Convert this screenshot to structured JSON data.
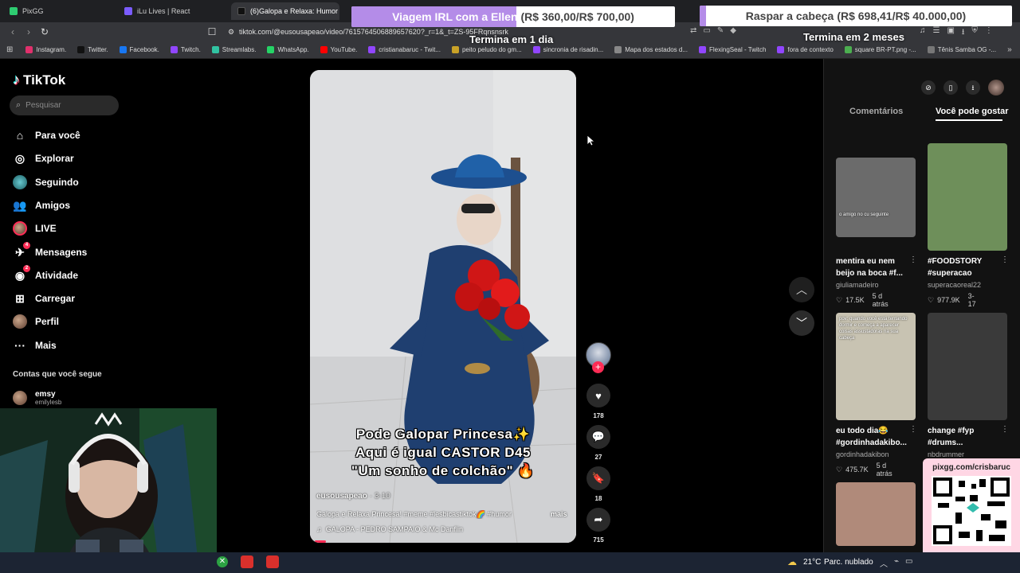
{
  "browser": {
    "tabs": [
      {
        "label": "PixGG",
        "color": "#2ecc71"
      },
      {
        "label": "iLu Lives | React",
        "color": "#7b5cff"
      },
      {
        "label": "(6)Galopa e Relaxa: Humor",
        "color": "#111111",
        "close": "✕"
      }
    ],
    "url": "tiktok.com/@eusousapeao/video/7615764506889657620?_r=1&_t=ZS-95FRqnsnsrk",
    "bookmarks": [
      {
        "label": "Instagram.",
        "color": "#e1306c"
      },
      {
        "label": "Twitter.",
        "color": "#111111"
      },
      {
        "label": "Facebook.",
        "color": "#1877f2"
      },
      {
        "label": "Twitch.",
        "color": "#9146ff"
      },
      {
        "label": "Streamlabs.",
        "color": "#31c3a2"
      },
      {
        "label": "WhatsApp.",
        "color": "#25d366"
      },
      {
        "label": "YouTube.",
        "color": "#ff0000"
      },
      {
        "label": "cristianabaruc - Twit...",
        "color": "#9146ff"
      },
      {
        "label": "peito peludo do gm...",
        "color": "#c9a227"
      },
      {
        "label": "sincronia de risadin...",
        "color": "#9146ff"
      },
      {
        "label": "Mapa dos estados d...",
        "color": "#888888"
      },
      {
        "label": "FlexingSeal - Twitch",
        "color": "#9146ff"
      },
      {
        "label": "fora de contexto",
        "color": "#9146ff"
      },
      {
        "label": "square BR-PT.png -...",
        "color": "#4caf50"
      },
      {
        "label": "Tênis Samba OG -...",
        "color": "#777777"
      }
    ]
  },
  "overlays": {
    "goal1": {
      "title": "Viagem IRL com a Ellen",
      "amount": "(R$ 360,00/R$ 700,00)",
      "sub": "Termina em 1 dia",
      "progress": 0.51,
      "fill": "#b48ce8"
    },
    "goal2": {
      "title": "Raspar a cabeça",
      "amount": "(R$ 698,41/R$ 40.000,00)",
      "sub": "Termina em 2 meses",
      "progress": 0.02,
      "fill": "#b48ce8"
    }
  },
  "sidebar": {
    "brand": "TikTok",
    "search_placeholder": "Pesquisar",
    "items": [
      {
        "label": "Para você",
        "icon": "home-icon",
        "glyph": "⌂"
      },
      {
        "label": "Explorar",
        "icon": "compass-icon",
        "glyph": "◎"
      },
      {
        "label": "Seguindo",
        "icon": "following-avatar-icon",
        "glyph": ""
      },
      {
        "label": "Amigos",
        "icon": "friends-icon",
        "glyph": "👥"
      },
      {
        "label": "LIVE",
        "icon": "live-avatar-icon",
        "glyph": ""
      },
      {
        "label": "Mensagens",
        "icon": "messages-icon",
        "glyph": "✈",
        "badge": "4"
      },
      {
        "label": "Atividade",
        "icon": "activity-icon",
        "glyph": "◉",
        "badge": "2"
      },
      {
        "label": "Carregar",
        "icon": "upload-icon",
        "glyph": "⊞"
      },
      {
        "label": "Perfil",
        "icon": "profile-avatar-icon",
        "glyph": ""
      },
      {
        "label": "Mais",
        "icon": "more-icon",
        "glyph": "···"
      }
    ],
    "following_heading": "Contas que você segue",
    "following": [
      {
        "name": "emsy",
        "handle": "emilylesb"
      }
    ]
  },
  "video": {
    "caption_lines": [
      "Pode Galopar Princesa✨",
      "Aqui é igual CASTOR D45",
      "\"Um sonho de colchão\" 🔥"
    ],
    "author": "eusousapeao",
    "date": "3-10",
    "description": "Galopa e Relaxa Princesa! #meme #lesbicastiktok🌈 #humor",
    "more": "mais",
    "music": "GALOPA - PEDRO SAMPAIO & Mc Danflin"
  },
  "actions": [
    {
      "name": "like",
      "icon": "heart-icon",
      "glyph": "♥",
      "count": "178"
    },
    {
      "name": "comment",
      "icon": "comment-icon",
      "glyph": "💬",
      "count": "27"
    },
    {
      "name": "save",
      "icon": "bookmark-icon",
      "glyph": "🔖",
      "count": "18"
    },
    {
      "name": "share",
      "icon": "share-icon",
      "glyph": "➦",
      "count": "715"
    }
  ],
  "right_panel": {
    "tabs": [
      "Comentários",
      "Você pode gostar"
    ],
    "cards": [
      {
        "title": "mentira eu nem beijo na boca #f...",
        "user": "giuliamadeiro",
        "likes": "17.5K",
        "date": "5 d atrás",
        "thumb_text": "o amigo no cu seguinte",
        "bg": "#6b6b6b"
      },
      {
        "title": "#FOODSTORY #superacao",
        "user": "superacaoreal22",
        "likes": "977.9K",
        "date": "3-17",
        "thumb_text": "",
        "bg": "#6e8f5a"
      },
      {
        "title": "eu todo dia😂 #gordinhadakibo...",
        "user": "gordinhadakibon",
        "likes": "475.7K",
        "date": "5 d atrás",
        "thumb_text": "pov: quando você está tentando dormir e começa a aparecer coisas assustadoras na sua cabeça",
        "bg": "#c8c3b2"
      },
      {
        "title": "change #fyp #drums...",
        "user": "nbdrummer",
        "likes": "",
        "date": "",
        "thumb_text": "",
        "bg": "#3a3a3a"
      },
      {
        "title": "",
        "user": "",
        "likes": "",
        "date": "",
        "thumb_text": "",
        "bg": "#b08a7a"
      }
    ],
    "pix_label": "pixgg.com/crisbaruc"
  },
  "taskbar": {
    "weather_temp": "21°C",
    "weather_desc": "Parc. nublado"
  }
}
